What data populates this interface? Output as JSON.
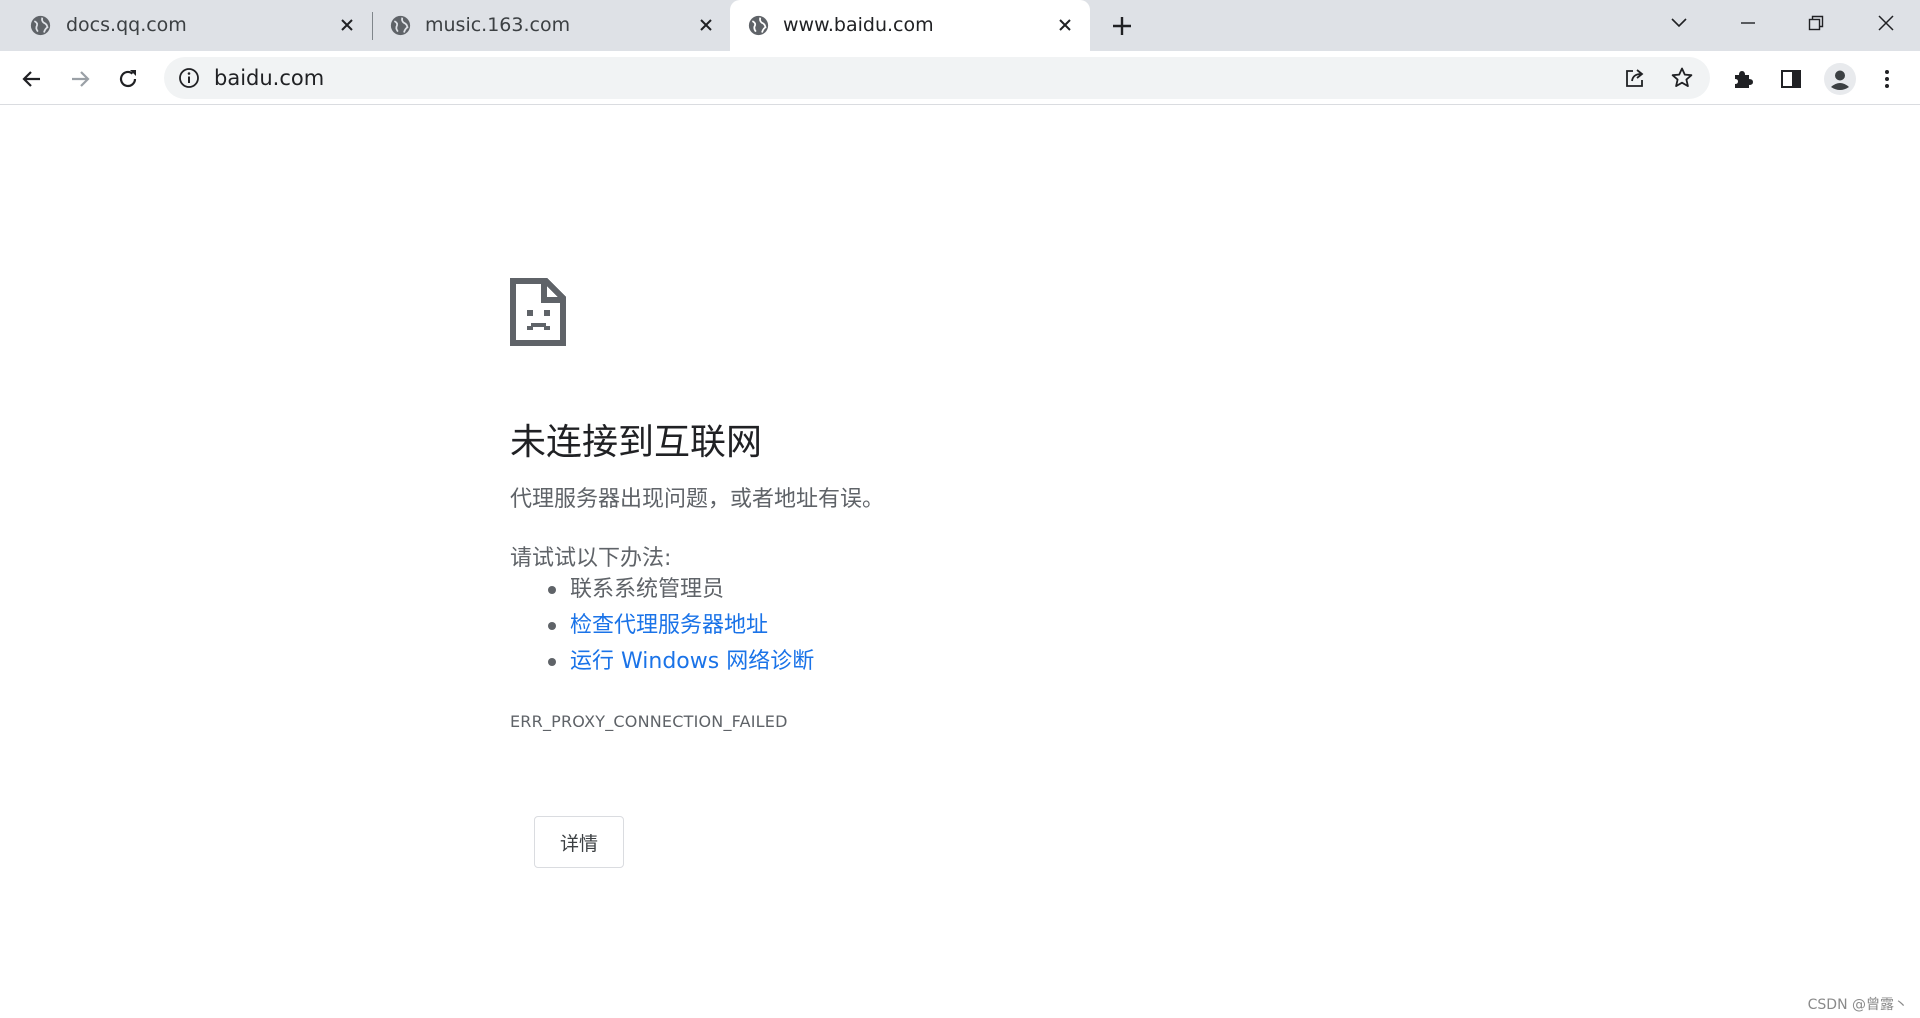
{
  "tabs": [
    {
      "title": "docs.qq.com",
      "active": false
    },
    {
      "title": "music.163.com",
      "active": false
    },
    {
      "title": "www.baidu.com",
      "active": true
    }
  ],
  "address_bar": {
    "url": "baidu.com"
  },
  "error_page": {
    "title": "未连接到互联网",
    "subtitle": "代理服务器出现问题，或者地址有误。",
    "try_label": "请试试以下办法:",
    "suggestions": [
      {
        "text": "联系系统管理员",
        "link": false
      },
      {
        "text": "检查代理服务器地址",
        "link": true
      },
      {
        "text": "运行 Windows 网络诊断",
        "link": true
      }
    ],
    "error_code": "ERR_PROXY_CONNECTION_FAILED",
    "details_button": "详情"
  },
  "watermark": "CSDN @曾露丶",
  "colors": {
    "tab_strip": "#dee1e6",
    "link": "#1a73e8",
    "text_secondary": "#5f6368"
  }
}
